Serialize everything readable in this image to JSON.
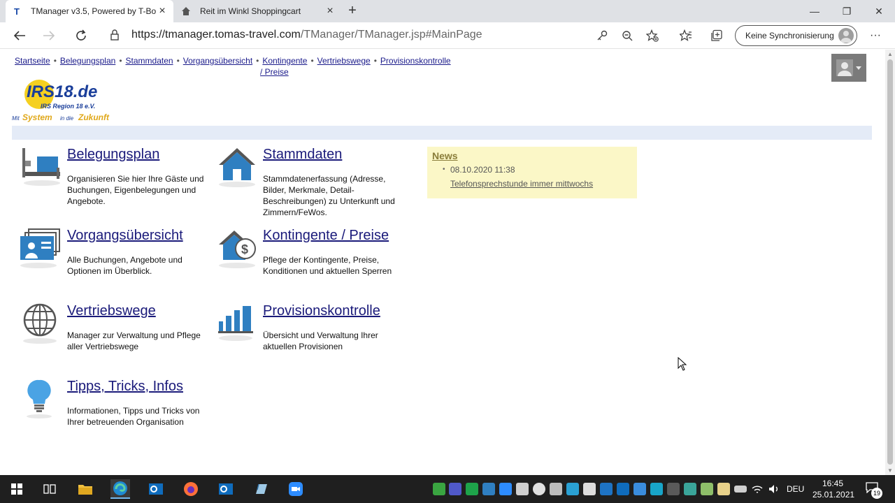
{
  "browser": {
    "tabs": [
      {
        "title": "TManager v3.5, Powered by T-Bo",
        "favicon": "T"
      },
      {
        "title": "Reit im Winkl Shoppingcart",
        "favicon": "house-icon"
      }
    ],
    "url_host": "https://tmanager.tomas-travel.com",
    "url_path": "/TManager/TManager.jsp#MainPage",
    "sync_label": "Keine Synchronisierung"
  },
  "nav": {
    "items": [
      "Startseite",
      "Belegungsplan",
      "Stammdaten",
      "Vorgangsübersicht",
      "Kontingente",
      "Vertriebswege",
      "Provisionskontrolle"
    ],
    "wrap": "/ Preise",
    "separator": "•"
  },
  "logo": {
    "line1": "IRS18.de",
    "line2": "IRS Region 18 e.V.",
    "slogan_a": "Mit",
    "slogan_b": "System",
    "slogan_c": "in die",
    "slogan_d": "Zukunft"
  },
  "tiles": [
    {
      "title": "Belegungsplan",
      "desc": "Organisieren Sie hier Ihre Gäste und Buchungen, Eigenbelegungen und Angebote.",
      "icon": "bed-icon"
    },
    {
      "title": "Stammdaten",
      "desc": "Stammdatenerfassung (Adresse, Bilder, Merkmale, Detail-Beschreibungen) zu Unterkunft und Zimmern/FeWos.",
      "icon": "house-icon"
    },
    {
      "title": "Vorgangsübersicht",
      "desc": "Alle Buchungen, Angebote und Optionen im Überblick.",
      "icon": "id-cards-icon"
    },
    {
      "title": "Kontingente / Preise",
      "desc": "Pflege der Kontingente, Preise, Konditionen und aktuellen Sperren",
      "icon": "house-dollar-icon"
    },
    {
      "title": "Vertriebswege",
      "desc": "Manager zur Verwaltung und Pflege aller Vertriebswege",
      "icon": "globe-icon"
    },
    {
      "title": "Provisionskontrolle",
      "desc": "Übersicht und Verwaltung Ihrer aktuellen Provisionen",
      "icon": "bar-chart-icon"
    },
    {
      "title": "Tipps, Tricks, Infos",
      "desc": "Informationen, Tipps und Tricks von Ihrer betreuenden Organisation",
      "icon": "lightbulb-icon"
    }
  ],
  "news": {
    "title": "News",
    "date": "08.10.2020 11:38",
    "link": "Telefonsprechstunde immer mittwochs"
  },
  "taskbar": {
    "lang": "DEU",
    "time": "16:45",
    "date": "25.01.2021",
    "notifications": "19"
  },
  "colors": {
    "link": "#1a1a7a",
    "news_bg": "#fbf7c7",
    "bar_bg": "#e4ebf7",
    "icon_blue": "#2f7fc1"
  }
}
